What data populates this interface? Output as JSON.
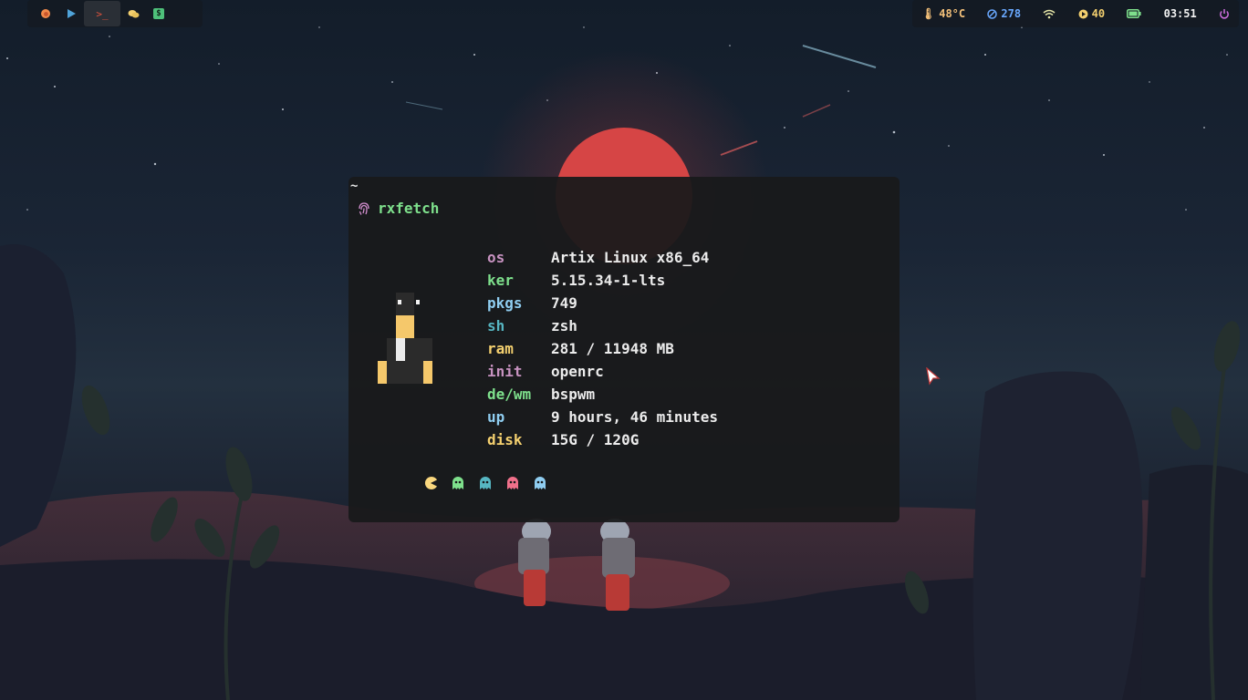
{
  "topbar": {
    "workspaces": [
      {
        "icon": "firefox-icon",
        "color": "#f08a4b",
        "active": false
      },
      {
        "icon": "play-icon",
        "color": "#4fa3d9",
        "active": false
      },
      {
        "icon": "terminal-prompt-icon",
        "label": ">_",
        "color": "#e0533d",
        "active": true
      },
      {
        "icon": "chat-bubble-icon",
        "color": "#f4d06f",
        "active": false
      },
      {
        "icon": "dollar-icon",
        "label": "$",
        "color": "#4ec07a",
        "active": false
      }
    ],
    "status": {
      "temperature": "48°C",
      "temperature_color": "#f4c17a",
      "updates": "278",
      "updates_color": "#6aa9ff",
      "brightness": "40",
      "brightness_color": "#f4d06f",
      "time": "03:51",
      "time_color": "#f2f2f2",
      "battery_color": "#7ee08c",
      "wifi_color": "#e7e7a8",
      "power_color": "#d06fe0"
    }
  },
  "terminal": {
    "cwd": "~",
    "prompt_icon": "fingerprint-icon",
    "prompt_icon_color": "#d48fd0",
    "command": "rxfetch",
    "info": [
      {
        "key": "os",
        "value": "Artix Linux x86_64",
        "color": "#c792c0"
      },
      {
        "key": "ker",
        "value": "5.15.34-1-lts",
        "color": "#7ee08c"
      },
      {
        "key": "pkgs",
        "value": "749",
        "color": "#8fcdf0"
      },
      {
        "key": "sh",
        "value": "zsh",
        "color": "#56b6c2"
      },
      {
        "key": "ram",
        "value": "281 / 11948 MB",
        "color": "#f4d06f"
      },
      {
        "key": "init",
        "value": "openrc",
        "color": "#c792c0"
      },
      {
        "key": "de/wm",
        "value": "bspwm",
        "color": "#7ee08c"
      },
      {
        "key": "up",
        "value": "9 hours, 46 minutes",
        "color": "#8fcdf0"
      },
      {
        "key": "disk",
        "value": "15G / 120G",
        "color": "#f4d06f"
      }
    ],
    "palette": [
      {
        "icon": "pacman-icon",
        "color": "#f9d77e"
      },
      {
        "icon": "ghost-icon",
        "color": "#7ee08c"
      },
      {
        "icon": "ghost-icon",
        "color": "#56b6c2"
      },
      {
        "icon": "ghost-icon",
        "color": "#f0708a"
      },
      {
        "icon": "ghost-icon",
        "color": "#8fcdf0"
      }
    ]
  }
}
